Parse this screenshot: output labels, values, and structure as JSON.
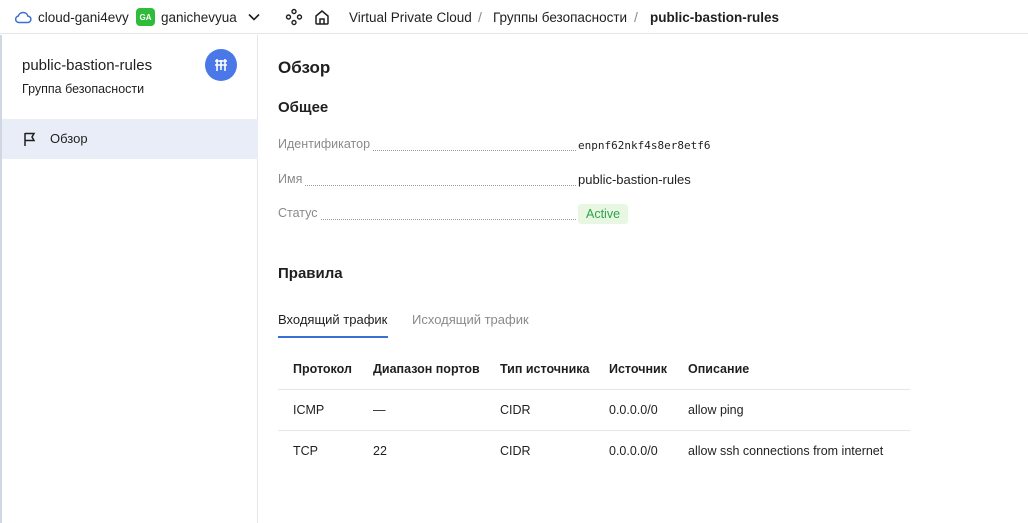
{
  "topbar": {
    "cloud_name": "cloud-gani4evy",
    "folder_badge": "GA",
    "folder_name": "ganichevyua",
    "breadcrumbs": [
      "Virtual Private Cloud",
      "Группы безопасности",
      "public-bastion-rules"
    ],
    "separator": "/"
  },
  "sidebar": {
    "title": "public-bastion-rules",
    "subtitle": "Группа безопасности",
    "nav": [
      {
        "label": "Обзор",
        "icon": "flag-icon",
        "active": true
      }
    ],
    "accent": "#4a78e8"
  },
  "main": {
    "heading": "Обзор",
    "general_heading": "Общее",
    "fields": {
      "id_label": "Идентификатор",
      "id_value": "enpnf62nkf4s8er8etf6",
      "name_label": "Имя",
      "name_value": "public-bastion-rules",
      "status_label": "Статус",
      "status_value": "Active"
    },
    "rules_heading": "Правила",
    "tabs": [
      "Входящий трафик",
      "Исходящий трафик"
    ],
    "table": {
      "columns": [
        "Протокол",
        "Диапазон портов",
        "Тип источника",
        "Источник",
        "Описание"
      ],
      "rows": [
        [
          "ICMP",
          "—",
          "CIDR",
          "0.0.0.0/0",
          "allow ping"
        ],
        [
          "TCP",
          "22",
          "CIDR",
          "0.0.0.0/0",
          "allow ssh connections from internet"
        ]
      ]
    }
  },
  "colors": {
    "status_bg": "#e7f7e2",
    "status_fg": "#31a24c",
    "tab_active": "#3a6fd8",
    "badge": "#2fbc3a"
  }
}
